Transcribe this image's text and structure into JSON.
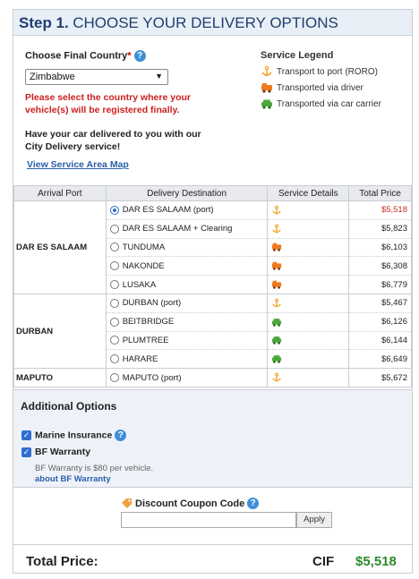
{
  "header": {
    "step": "Step 1.",
    "title": "CHOOSE YOUR DELIVERY OPTIONS"
  },
  "country": {
    "label": "Choose Final Country",
    "required_mark": "*",
    "selected": "Zimbabwe",
    "warning": "Please select the country where your vehicle(s) will be registered finally.",
    "delivery_text": "Have your car delivered to you with our City Delivery service!",
    "map_link": "View Service Area Map"
  },
  "legend": {
    "title": "Service Legend",
    "items": [
      {
        "icon": "anchor-icon",
        "label": "Transport to port (RORO)",
        "color": "#f0a020"
      },
      {
        "icon": "truck-driver-icon",
        "label": "Transported via driver",
        "color": "#f07a20"
      },
      {
        "icon": "car-carrier-icon",
        "label": "Transported via car carrier",
        "color": "#4aa83a"
      }
    ]
  },
  "table": {
    "headers": [
      "Arrival Port",
      "Delivery Destination",
      "Service Details",
      "Total Price"
    ],
    "groups": [
      {
        "port": "DAR ES SALAAM",
        "rows": [
          {
            "dest": "DAR ES SALAAM",
            "note": "(port)",
            "service": "anchor",
            "price": "$5,518",
            "selected": true
          },
          {
            "dest": "DAR ES SALAAM + Clearing",
            "note": "",
            "service": "anchor",
            "price": "$5,823",
            "selected": false
          },
          {
            "dest": "TUNDUMA",
            "note": "",
            "service": "driver",
            "price": "$6,103",
            "selected": false
          },
          {
            "dest": "NAKONDE",
            "note": "",
            "service": "driver",
            "price": "$6,308",
            "selected": false
          },
          {
            "dest": "LUSAKA",
            "note": "",
            "service": "driver",
            "price": "$6,779",
            "selected": false
          }
        ]
      },
      {
        "port": "DURBAN",
        "rows": [
          {
            "dest": "DURBAN",
            "note": "(port)",
            "service": "anchor",
            "price": "$5,467",
            "selected": false
          },
          {
            "dest": "BEITBRIDGE",
            "note": "",
            "service": "carrier",
            "price": "$6,126",
            "selected": false
          },
          {
            "dest": "PLUMTREE",
            "note": "",
            "service": "carrier",
            "price": "$6,144",
            "selected": false
          },
          {
            "dest": "HARARE",
            "note": "",
            "service": "carrier",
            "price": "$6,649",
            "selected": false
          }
        ]
      },
      {
        "port": "MAPUTO",
        "rows": [
          {
            "dest": "MAPUTO",
            "note": "(port)",
            "service": "anchor",
            "price": "$5,672",
            "selected": false
          }
        ]
      }
    ]
  },
  "additional": {
    "title": "Additional Options",
    "marine_insurance": "Marine Insurance",
    "bf_warranty": "BF Warranty",
    "warranty_note": "BF Warranty is $80 per vehicle.",
    "warranty_link": "about BF Warranty"
  },
  "coupon": {
    "label": "Discount Coupon Code",
    "apply": "Apply",
    "value": ""
  },
  "total": {
    "label": "Total Price:",
    "term": "CIF",
    "value": "$5,518"
  }
}
